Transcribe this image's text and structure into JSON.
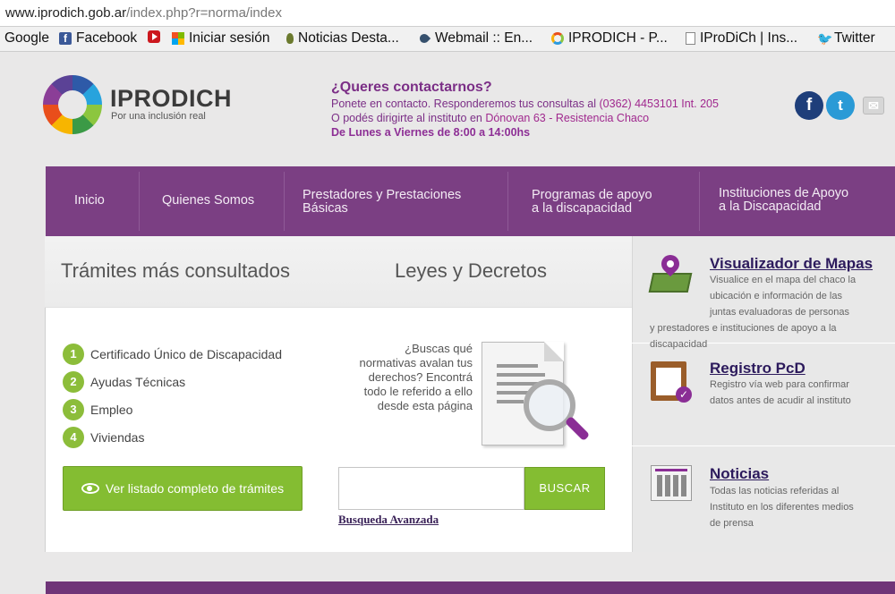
{
  "browser": {
    "url_domain": "www.iprodich.gob.ar",
    "url_path": "/index.php?r=norma/index",
    "bookmarks": [
      {
        "label": "Google",
        "icon": "none"
      },
      {
        "label": "Facebook",
        "icon": "facebook-icon"
      },
      {
        "label": "Iniciar sesión",
        "icon": "microsoft-icon"
      },
      {
        "label": "Noticias Desta...",
        "icon": "leaf-icon"
      },
      {
        "label": "Webmail :: En...",
        "icon": "drop-icon"
      },
      {
        "label": "IPRODICH - P...",
        "icon": "ring-icon"
      },
      {
        "label": "IProDiCh | Ins...",
        "icon": "page-icon"
      },
      {
        "label": "Twitter",
        "icon": "twitter-icon"
      }
    ]
  },
  "header": {
    "logo_title": "IPRODICH",
    "logo_subtitle": "Por una inclusión real",
    "contact_question": "¿Queres contactarnos?",
    "contact_line1_text": "Ponete en contacto. Responderemos tus consultas al ",
    "contact_phone": "(0362) 4453101 Int. 205",
    "contact_line2_text": "O podés dirigirte al instituto en ",
    "contact_address": "Dónovan 63 - Resistencia Chaco",
    "contact_hours": "De Lunes a Viernes de 8:00 a 14:00hs",
    "social": {
      "facebook": "f",
      "twitter": "t",
      "mail": "✉"
    }
  },
  "nav": {
    "items": [
      {
        "line1": "Inicio",
        "line2": ""
      },
      {
        "line1": "Quienes Somos",
        "line2": ""
      },
      {
        "line1": "Prestadores y Prestaciones",
        "line2": "Básicas"
      },
      {
        "line1": "Programas de apoyo",
        "line2": "a la discapacidad"
      },
      {
        "line1": "Instituciones de Apoyo",
        "line2": "a la Discapacidad"
      }
    ]
  },
  "tramites": {
    "title": "Trámites más consultados",
    "items": [
      {
        "num": "1",
        "label": "Certificado Único de Discapacidad"
      },
      {
        "num": "2",
        "label": "Ayudas Técnicas"
      },
      {
        "num": "3",
        "label": "Empleo"
      },
      {
        "num": "4",
        "label": "Viviendas"
      }
    ],
    "button_label": "Ver listado completo de trámites"
  },
  "leyes": {
    "title": "Leyes y Decretos",
    "text_lines": [
      "¿Buscas qué",
      "normativas avalan tus",
      "derechos? Encontrá",
      "todo le referido a ello",
      "desde esta página"
    ],
    "search_value": "",
    "search_button": "BUSCAR",
    "advanced_link": "Busqueda Avanzada"
  },
  "sidebar": {
    "mapas_title": "Visualizador de Mapas",
    "mapas_lines": [
      "Visualice en el mapa del chaco la",
      "ubicación e información de las",
      "juntas evaluadoras de personas",
      "y prestadores e instituciones de apoyo a la",
      "discapacidad"
    ],
    "registro_title": "Registro PcD",
    "registro_lines": [
      "Registro vía web para confirmar",
      "datos antes de acudir al instituto"
    ],
    "noticias_title": "Noticias",
    "noticias_lines": [
      "Todas las noticias referidas al",
      "Instituto en los diferentes medios",
      "de prensa"
    ]
  },
  "colors": {
    "purple": "#7b3f83",
    "green": "#84bd32",
    "link": "#2c1a5c"
  }
}
